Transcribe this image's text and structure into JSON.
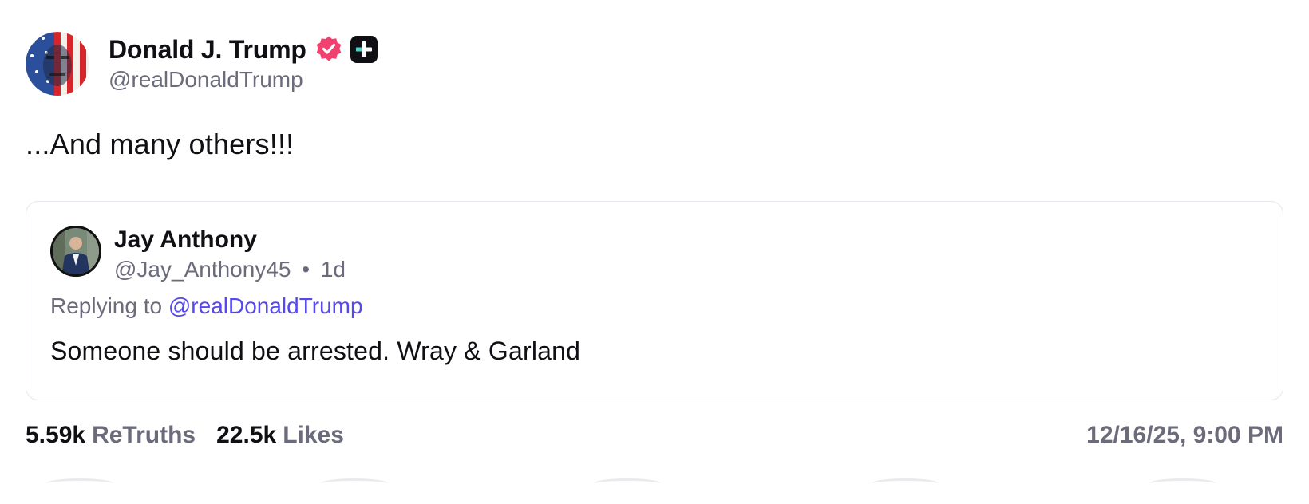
{
  "post": {
    "author_name": "Donald J. Trump",
    "author_handle": "@realDonaldTrump",
    "verified_icon": "verified-badge-icon",
    "plus_icon": "plus-badge-icon",
    "body": "...And many others!!!",
    "colors": {
      "verified": "#f2416e",
      "mention": "#5448ee",
      "muted": "#6b6b7b"
    }
  },
  "quote": {
    "author_name": "Jay Anthony",
    "author_handle": "@Jay_Anthony45",
    "separator": "•",
    "age": "1d",
    "replying_prefix": "Replying to",
    "replying_mention": "@realDonaldTrump",
    "text": "Someone should be arrested. Wray & Garland"
  },
  "stats": {
    "retruths_count": "5.59k",
    "retruths_label": "ReTruths",
    "likes_count": "22.5k",
    "likes_label": "Likes",
    "timestamp": "12/16/25, 9:00 PM"
  }
}
